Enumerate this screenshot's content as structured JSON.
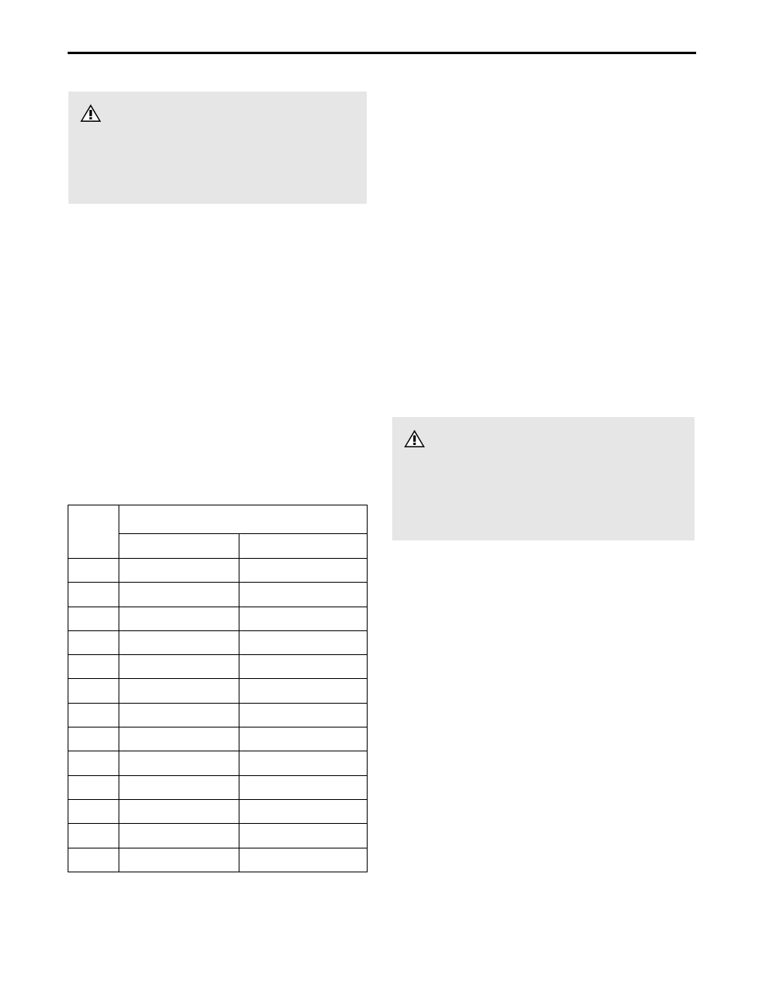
{
  "page": {
    "hr_top": true
  },
  "warning1": {
    "present": true
  },
  "warning2": {
    "present": true
  },
  "table": {
    "num_data_rows": 13,
    "header_span_top": true,
    "header_sub_cols": 2
  }
}
